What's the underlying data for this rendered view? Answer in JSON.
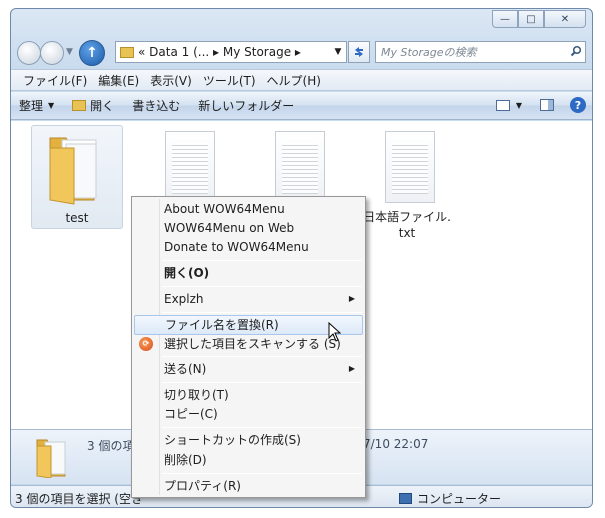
{
  "window": {
    "caption_min": "—",
    "caption_max": "□",
    "caption_close": "✕"
  },
  "nav": {
    "history_caret": "▼",
    "up_arrow": "↑",
    "address_crumbs": "«  Data 1 (...  ▸  My Storage  ▸",
    "address_dropdown": "▼",
    "refresh_icon": "refresh-icon",
    "search_placeholder": "My Storageの検索"
  },
  "menubar": {
    "items": [
      "ファイル(F)",
      "編集(E)",
      "表示(V)",
      "ツール(T)",
      "ヘルプ(H)"
    ]
  },
  "commandbar": {
    "organize": "整理",
    "open": "開く",
    "burn": "書き込む",
    "new_folder": "新しいフォルダー",
    "help": "?"
  },
  "files": [
    {
      "name": "test",
      "type": "folder",
      "selected": true
    },
    {
      "name": "",
      "type": "text"
    },
    {
      "name": "",
      "type": "text"
    },
    {
      "name": "日本語ファイル.txt",
      "name_line1": "日本語ファイル.",
      "name_line2": "txt",
      "type": "text"
    }
  ],
  "details": {
    "summary": "3 個の項目",
    "date": "7/10 22:07"
  },
  "status": {
    "text": "3 個の項目を選択 (空き",
    "computer": "コンピューター"
  },
  "context_menu": {
    "about": "About WOW64Menu",
    "web": "WOW64Menu on Web",
    "donate": "Donate to WOW64Menu",
    "open": "開く(O)",
    "explzh": "Explzh",
    "rename": "ファイル名を置換(R)",
    "scan": "選択した項目をスキャンする (S)",
    "send_to": "送る(N)",
    "cut": "切り取り(T)",
    "copy": "コピー(C)",
    "shortcut": "ショートカットの作成(S)",
    "delete": "削除(D)",
    "properties": "プロパティ(R)",
    "submenu_arrow": "▶",
    "highlighted": "rename"
  }
}
